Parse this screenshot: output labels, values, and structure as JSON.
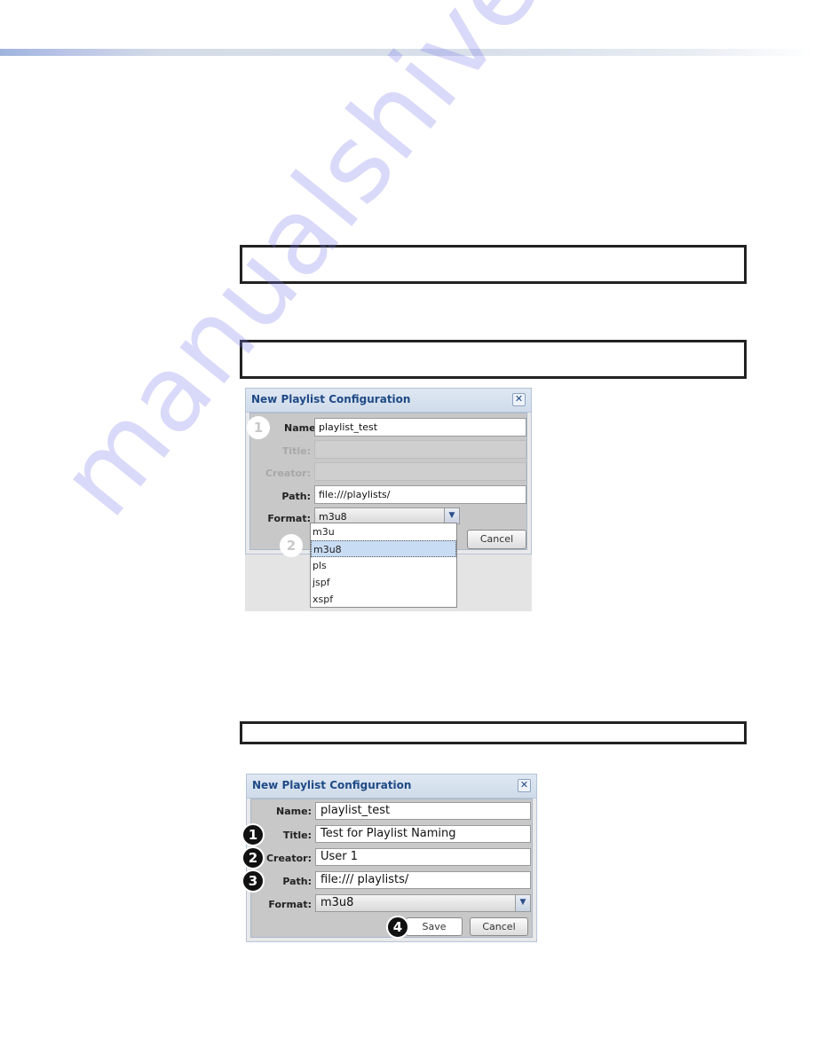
{
  "page": {
    "accent_color": "#1f4a86",
    "watermark": "manualshive.com"
  },
  "dialog_1": {
    "title": "New Playlist Configuration",
    "close_icon": "close-icon",
    "fields": {
      "name": {
        "label": "Name:",
        "value": "playlist_test"
      },
      "title": {
        "label": "Title:",
        "value": "",
        "disabled": true
      },
      "creator": {
        "label": "Creator:",
        "value": "",
        "disabled": true
      },
      "path": {
        "label": "Path:",
        "value": "file:///playlists/"
      },
      "format": {
        "label": "Format:",
        "value": "m3u8"
      }
    },
    "format_options": [
      "m3u",
      "m3u8",
      "pls",
      "jspf",
      "xspf"
    ],
    "selected_option": "m3u8",
    "cancel_label": "Cancel",
    "callouts": [
      "1",
      "2"
    ]
  },
  "dialog_2": {
    "title": "New Playlist Configuration",
    "close_icon": "close-icon",
    "fields": {
      "name": {
        "label": "Name:",
        "value": "playlist_test"
      },
      "title": {
        "label": "Title:",
        "value": "Test for Playlist Naming"
      },
      "creator": {
        "label": "Creator:",
        "value": "User 1"
      },
      "path": {
        "label": "Path:",
        "value": "file:/// playlists/"
      },
      "format": {
        "label": "Format:",
        "value": "m3u8"
      }
    },
    "save_label": "Save",
    "cancel_label": "Cancel",
    "callouts": [
      "1",
      "2",
      "3",
      "4"
    ]
  }
}
